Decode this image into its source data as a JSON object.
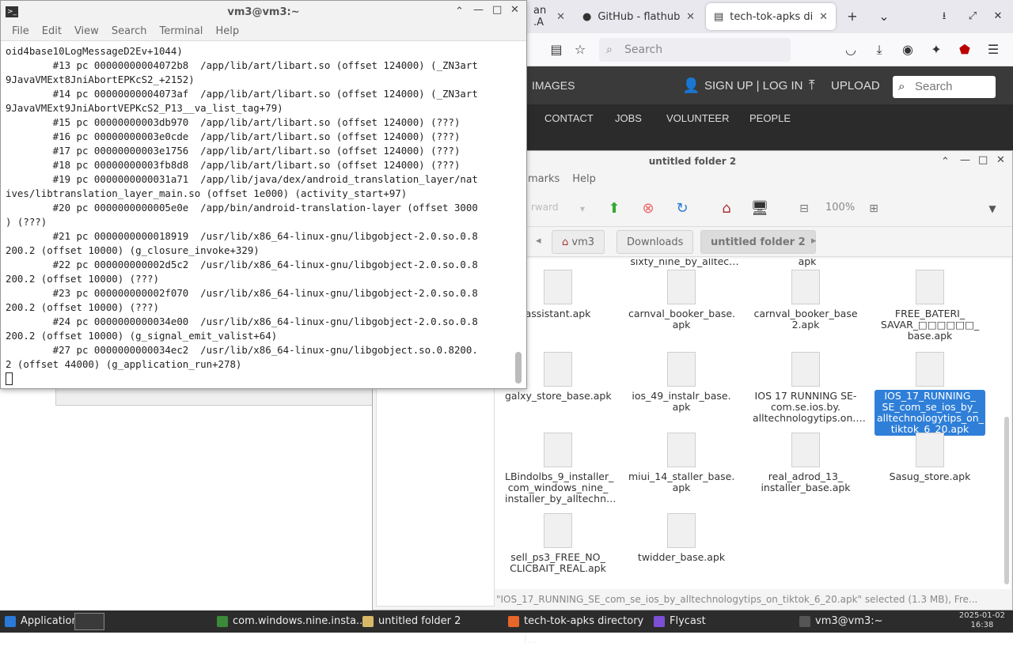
{
  "firefox": {
    "tabs": [
      {
        "label": "an .A",
        "active": false
      },
      {
        "label": "GitHub - flathub/io",
        "active": false
      },
      {
        "label": "tech-tok-apks direc",
        "active": true
      }
    ],
    "search_placeholder": "Search"
  },
  "site": {
    "images": "IMAGES",
    "signup": "SIGN UP | LOG IN",
    "upload": "UPLOAD",
    "search_placeholder": "Search",
    "nav": [
      "CONTACT",
      "JOBS",
      "VOLUNTEER",
      "PEOPLE"
    ]
  },
  "terminal": {
    "title": "vm3@vm3:~",
    "menu": [
      "File",
      "Edit",
      "View",
      "Search",
      "Terminal",
      "Help"
    ],
    "lines": [
      "oid4base10LogMessageD2Ev+1044)",
      "        #13 pc 00000000004072b8  /app/lib/art/libart.so (offset 124000) (_ZN3art",
      "9JavaVMExt8JniAbortEPKcS2_+2152)",
      "        #14 pc 00000000004073af  /app/lib/art/libart.so (offset 124000) (_ZN3art",
      "9JavaVMExt9JniAbortVEPKcS2_P13__va_list_tag+79)",
      "        #15 pc 00000000003db970  /app/lib/art/libart.so (offset 124000) (???)",
      "        #16 pc 00000000003e0cde  /app/lib/art/libart.so (offset 124000) (???)",
      "        #17 pc 00000000003e1756  /app/lib/art/libart.so (offset 124000) (???)",
      "        #18 pc 00000000003fb8d8  /app/lib/art/libart.so (offset 124000) (???)",
      "        #19 pc 0000000000031a71  /app/lib/java/dex/android_translation_layer/nat",
      "ives/libtranslation_layer_main.so (offset 1e000) (activity_start+97)",
      "        #20 pc 0000000000005e0e  /app/bin/android-translation-layer (offset 3000",
      ") (???)",
      "        #21 pc 0000000000018919  /usr/lib/x86_64-linux-gnu/libgobject-2.0.so.0.8",
      "200.2 (offset 10000) (g_closure_invoke+329)",
      "        #22 pc 000000000002d5c2  /usr/lib/x86_64-linux-gnu/libgobject-2.0.so.0.8",
      "200.2 (offset 10000) (???)",
      "        #23 pc 000000000002f070  /usr/lib/x86_64-linux-gnu/libgobject-2.0.so.0.8",
      "200.2 (offset 10000) (???)",
      "        #24 pc 0000000000034e00  /usr/lib/x86_64-linux-gnu/libgobject-2.0.so.0.8",
      "200.2 (offset 10000) (g_signal_emit_valist+64)",
      "        #27 pc 0000000000034ec2  /usr/lib/x86_64-linux-gnu/libgobject.so.0.8200.",
      "2 (offset 44000) (g_application_run+278)"
    ]
  },
  "filemanager": {
    "title": "untitled folder 2",
    "menu": [
      "marks",
      "Help"
    ],
    "toolbar": {
      "forward": "rward",
      "zoom": "100%"
    },
    "breadcrumbs": [
      "vm3",
      "Downloads",
      "untitled folder 2"
    ],
    "partial_top": [
      "sixty_nine_by_alltec…",
      "apk"
    ],
    "files": [
      {
        "name": "assistant.apk",
        "selected": false
      },
      {
        "name": "carnval_booker_base.\napk",
        "selected": false
      },
      {
        "name": "carnval_booker_base\n2.apk",
        "selected": false
      },
      {
        "name": "FREE_BATERI_\nSAVAR_□□□□□□_\nbase.apk",
        "selected": false
      },
      {
        "name": "galxy_store_base.apk",
        "selected": false
      },
      {
        "name": "ios_49_instalr_base.\napk",
        "selected": false
      },
      {
        "name": "IOS 17 RUNNING SE-\ncom.se.ios.by.\nalltechnologytips.on.…",
        "selected": false
      },
      {
        "name": "IOS_17_RUNNING_\nSE_com_se_ios_by_\nalltechnologytips_on_\ntiktok_6_20.apk",
        "selected": true
      },
      {
        "name": "LBindolbs_9_installer_\ncom_windows_nine_\ninstaller_by_alltechn…",
        "selected": false
      },
      {
        "name": "miui_14_staller_base.\napk",
        "selected": false
      },
      {
        "name": "real_adrod_13_\ninstaller_base.apk",
        "selected": false
      },
      {
        "name": "Sasug_store.apk",
        "selected": false
      },
      {
        "name": "sell_ps3_FREE_NO_\nCLICBAIT_REAL.apk",
        "selected": false
      },
      {
        "name": "twidder_base.apk",
        "selected": false
      }
    ],
    "status": "\"IOS_17_RUNNING_SE_com_se_ios_by_alltechnologytips_on_tiktok_6_20.apk\" selected (1.3 MB), Fre..."
  },
  "taskbar": {
    "applications": "Applications",
    "items": [
      {
        "label": "com.windows.nine.insta...",
        "color": "#3a8a3a"
      },
      {
        "label": "untitled folder 2",
        "color": "#d9b86a"
      },
      {
        "label": "tech-tok-apks directory l...",
        "color": "#e8662a"
      },
      {
        "label": "Flycast",
        "color": "#7b4fd6"
      },
      {
        "label": "vm3@vm3:~",
        "color": "#555555"
      }
    ],
    "date": "2025-01-02",
    "time": "16:38"
  }
}
